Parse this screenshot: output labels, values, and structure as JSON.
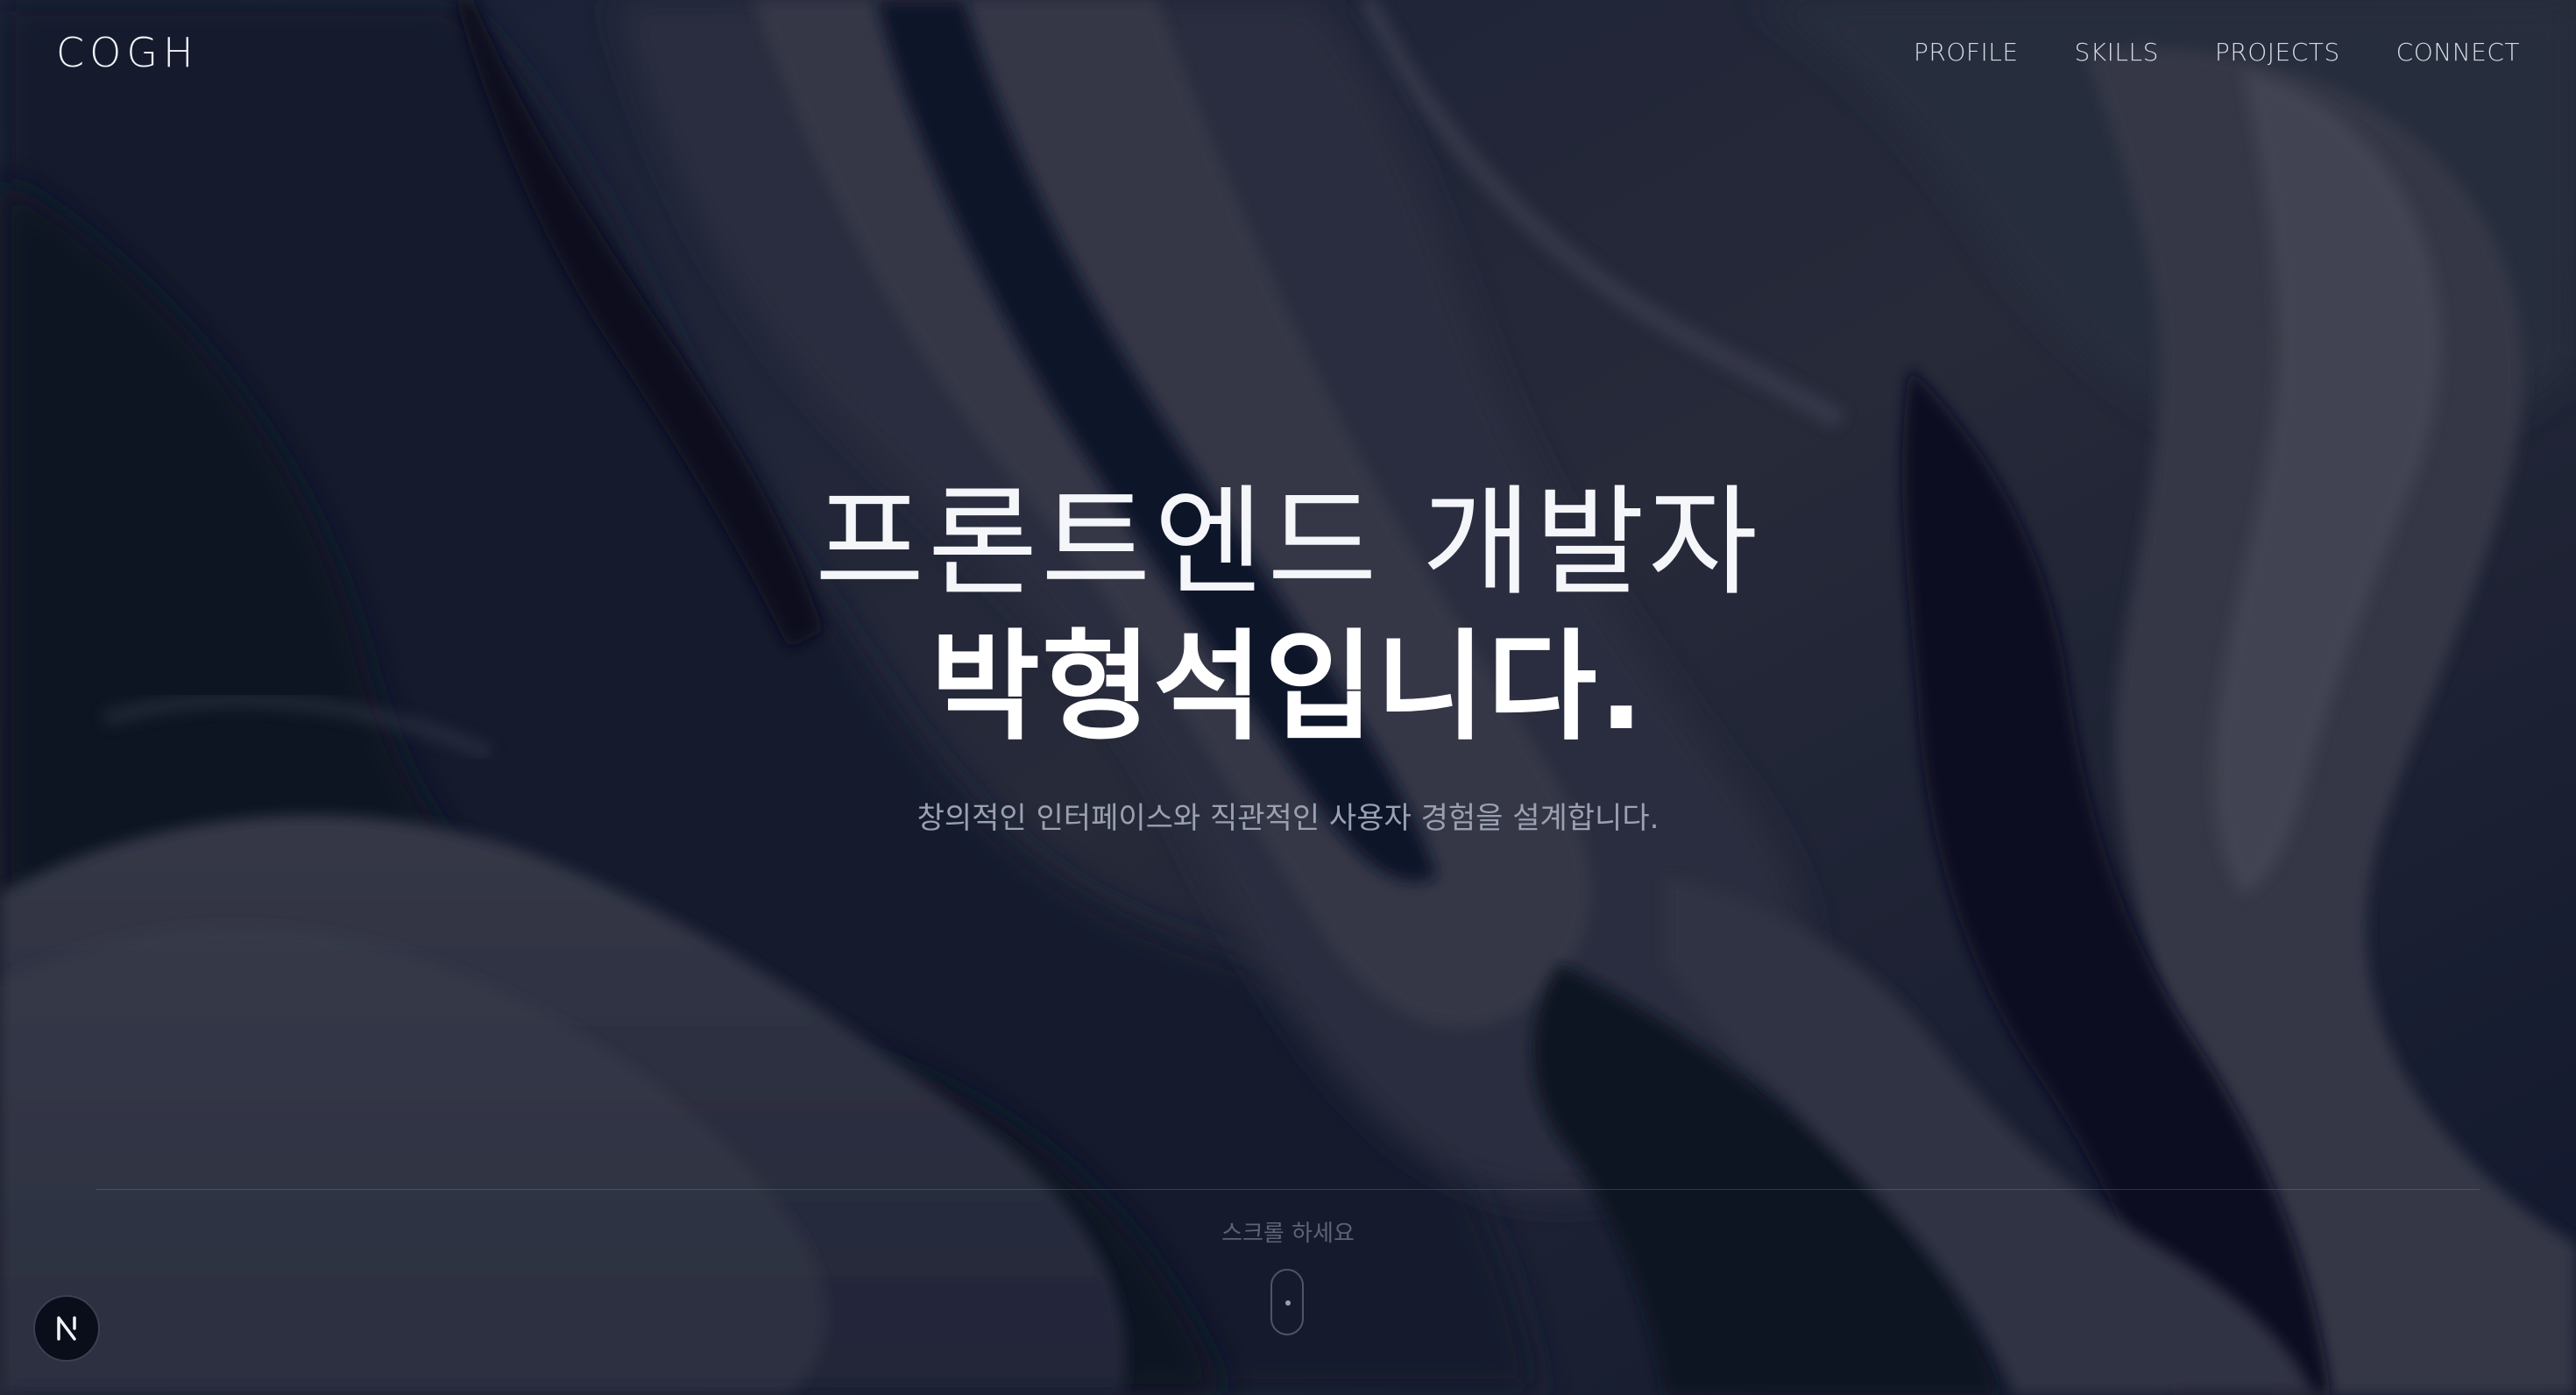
{
  "header": {
    "logo": "COGH",
    "nav": [
      {
        "label": "PROFILE"
      },
      {
        "label": "SKILLS"
      },
      {
        "label": "PROJECTS"
      },
      {
        "label": "CONNECT"
      }
    ]
  },
  "hero": {
    "line1": "프론트엔드 개발자",
    "line2": "박형석입니다.",
    "subtitle": "창의적인 인터페이스와 직관적인 사용자 경험을 설계합니다."
  },
  "scroll": {
    "hint": "스크롤 하세요",
    "icon": "mouse-scroll-icon"
  },
  "badge": {
    "icon": "nextjs-n-icon"
  },
  "colors": {
    "background": "#0d1428",
    "wave_light": "#3a3d4a",
    "wave_dark": "#0b1122",
    "text_primary": "#ffffff",
    "text_secondary": "#9aa1b1"
  }
}
